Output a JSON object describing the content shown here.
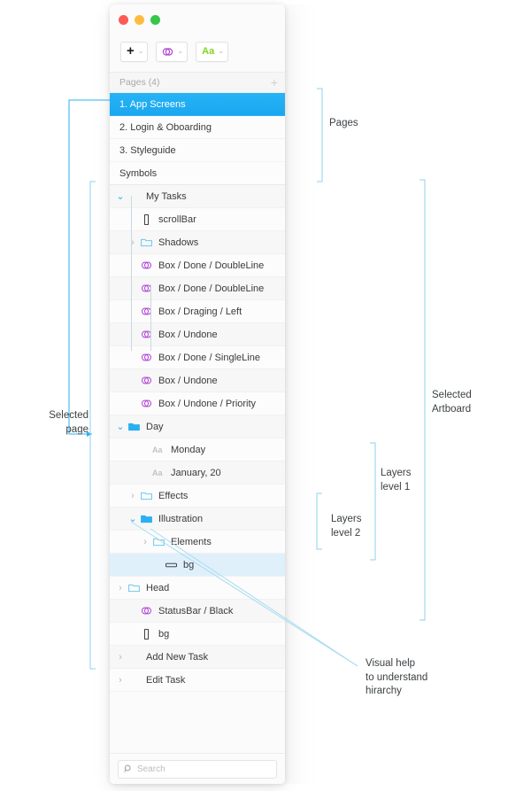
{
  "window": {
    "traffic_lights": [
      "close",
      "minimize",
      "zoom"
    ],
    "colors": {
      "close": "#fc5c54",
      "minimize": "#fdbc40",
      "zoom": "#34c749",
      "selection_blue": "#27b3f5",
      "highlight_blue": "#dff0fb",
      "symbol_purple": "#b044d6",
      "text_green": "#7ed321",
      "folder_blue": "#29b0f1",
      "annotation_line": "#8ed2f0"
    }
  },
  "toolbar": {
    "buttons": [
      {
        "glyph": "+",
        "icon": "plus-icon",
        "caret": "⌄"
      },
      {
        "glyph": "",
        "icon": "symbol-icon",
        "caret": "⌄"
      },
      {
        "glyph": "Aa",
        "icon": "text-icon",
        "caret": "⌄"
      }
    ]
  },
  "pages_section": {
    "header": "Pages (4)",
    "add_label": "+",
    "items": [
      {
        "label": "1. App Screens",
        "selected": true
      },
      {
        "label": "2. Login & Oboarding",
        "selected": false
      },
      {
        "label": "3. Styleguide",
        "selected": false
      },
      {
        "label": "Symbols",
        "selected": false
      }
    ]
  },
  "layers_section": {
    "items": [
      {
        "label": "My Tasks",
        "icon": "none",
        "indent": 0,
        "disclosure": "open",
        "state": "alt"
      },
      {
        "label": "scrollBar",
        "icon": "shape",
        "indent": 1,
        "disclosure": "none",
        "state": "normal"
      },
      {
        "label": "Shadows",
        "icon": "folder",
        "indent": 1,
        "disclosure": "closed",
        "state": "alt"
      },
      {
        "label": "Box / Done / DoubleLine",
        "icon": "symbol",
        "indent": 1,
        "disclosure": "none",
        "state": "normal"
      },
      {
        "label": "Box / Done / DoubleLine",
        "icon": "symbol",
        "indent": 1,
        "disclosure": "none",
        "state": "alt"
      },
      {
        "label": "Box / Draging / Left",
        "icon": "symbol",
        "indent": 1,
        "disclosure": "none",
        "state": "normal"
      },
      {
        "label": "Box / Undone",
        "icon": "symbol",
        "indent": 1,
        "disclosure": "none",
        "state": "alt"
      },
      {
        "label": "Box / Done / SingleLine",
        "icon": "symbol",
        "indent": 1,
        "disclosure": "none",
        "state": "normal"
      },
      {
        "label": "Box / Undone",
        "icon": "symbol",
        "indent": 1,
        "disclosure": "none",
        "state": "alt"
      },
      {
        "label": "Box / Undone / Priority",
        "icon": "symbol",
        "indent": 1,
        "disclosure": "none",
        "state": "normal"
      },
      {
        "label": "Day",
        "icon": "folder-filled",
        "indent": 0,
        "disclosure": "open",
        "state": "alt"
      },
      {
        "label": "Monday",
        "icon": "text",
        "indent": 2,
        "disclosure": "none",
        "state": "normal"
      },
      {
        "label": "January, 20",
        "icon": "text",
        "indent": 2,
        "disclosure": "none",
        "state": "alt"
      },
      {
        "label": "Effects",
        "icon": "folder",
        "indent": 1,
        "disclosure": "closed",
        "state": "normal"
      },
      {
        "label": "Illustration",
        "icon": "folder-filled",
        "indent": 1,
        "disclosure": "open",
        "state": "alt"
      },
      {
        "label": "Elements",
        "icon": "folder",
        "indent": 2,
        "disclosure": "closed",
        "state": "normal"
      },
      {
        "label": "bg",
        "icon": "rect",
        "indent": 3,
        "disclosure": "none",
        "state": "highlight"
      },
      {
        "label": "Head",
        "icon": "folder",
        "indent": 0,
        "disclosure": "closed",
        "state": "normal"
      },
      {
        "label": "StatusBar / Black",
        "icon": "symbol",
        "indent": 1,
        "disclosure": "none",
        "state": "alt"
      },
      {
        "label": "bg",
        "icon": "shape",
        "indent": 1,
        "disclosure": "none",
        "state": "normal"
      },
      {
        "label": "Add New Task",
        "icon": "none",
        "indent": 0,
        "disclosure": "closed",
        "state": "alt"
      },
      {
        "label": "Edit Task",
        "icon": "none",
        "indent": 0,
        "disclosure": "closed",
        "state": "normal"
      }
    ]
  },
  "search": {
    "placeholder": "Search",
    "value": "",
    "icon": "search-icon"
  },
  "annotations": {
    "selected_page": "Selected\npage",
    "pages": "Pages",
    "selected_artboard": "Selected\nArtboard",
    "layers_level_1": "Layers\nlevel 1",
    "layers_level_2": "Layers\nlevel 2",
    "visual_help": "Visual help\nto understand\nhirarchy"
  }
}
